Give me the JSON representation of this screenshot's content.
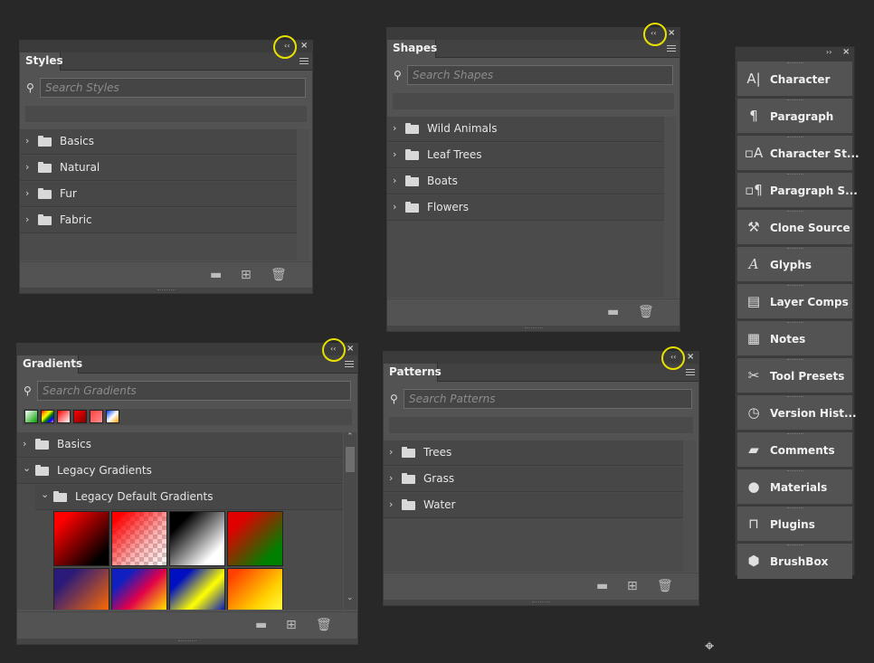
{
  "styles_panel": {
    "tab": "Styles",
    "search_placeholder": "Search Styles",
    "items": [
      {
        "label": "Basics"
      },
      {
        "label": "Natural"
      },
      {
        "label": "Fur"
      },
      {
        "label": "Fabric"
      }
    ]
  },
  "shapes_panel": {
    "tab": "Shapes",
    "search_placeholder": "Search Shapes",
    "items": [
      {
        "label": "Wild Animals"
      },
      {
        "label": "Leaf Trees"
      },
      {
        "label": "Boats"
      },
      {
        "label": "Flowers"
      }
    ]
  },
  "gradients_panel": {
    "tab": "Gradients",
    "search_placeholder": "Search Gradients",
    "items": [
      {
        "label": "Basics",
        "expanded": false
      },
      {
        "label": "Legacy Gradients",
        "expanded": true
      },
      {
        "label": "Legacy Default Gradients",
        "expanded": true
      }
    ]
  },
  "patterns_panel": {
    "tab": "Patterns",
    "search_placeholder": "Search Patterns",
    "items": [
      {
        "label": "Trees"
      },
      {
        "label": "Grass"
      },
      {
        "label": "Water"
      }
    ]
  },
  "dock": {
    "items": [
      {
        "label": "Character",
        "icon": "character-icon"
      },
      {
        "label": "Paragraph",
        "icon": "paragraph-icon"
      },
      {
        "label": "Character St...",
        "icon": "character-styles-icon"
      },
      {
        "label": "Paragraph S...",
        "icon": "paragraph-styles-icon"
      },
      {
        "label": "Clone Source",
        "icon": "clone-source-icon"
      },
      {
        "label": "Glyphs",
        "icon": "glyphs-icon"
      },
      {
        "label": "Layer Comps",
        "icon": "layer-comps-icon"
      },
      {
        "label": "Notes",
        "icon": "notes-icon"
      },
      {
        "label": "Tool Presets",
        "icon": "tool-presets-icon"
      },
      {
        "label": "Version Hist...",
        "icon": "version-history-icon"
      },
      {
        "label": "Comments",
        "icon": "comments-icon"
      },
      {
        "label": "Materials",
        "icon": "materials-icon"
      },
      {
        "label": "Plugins",
        "icon": "plugins-icon"
      },
      {
        "label": "BrushBox",
        "icon": "brushbox-icon"
      }
    ]
  },
  "colors": {
    "background": "#282828",
    "panel": "#535353",
    "highlight_ring": "#e8e000"
  }
}
